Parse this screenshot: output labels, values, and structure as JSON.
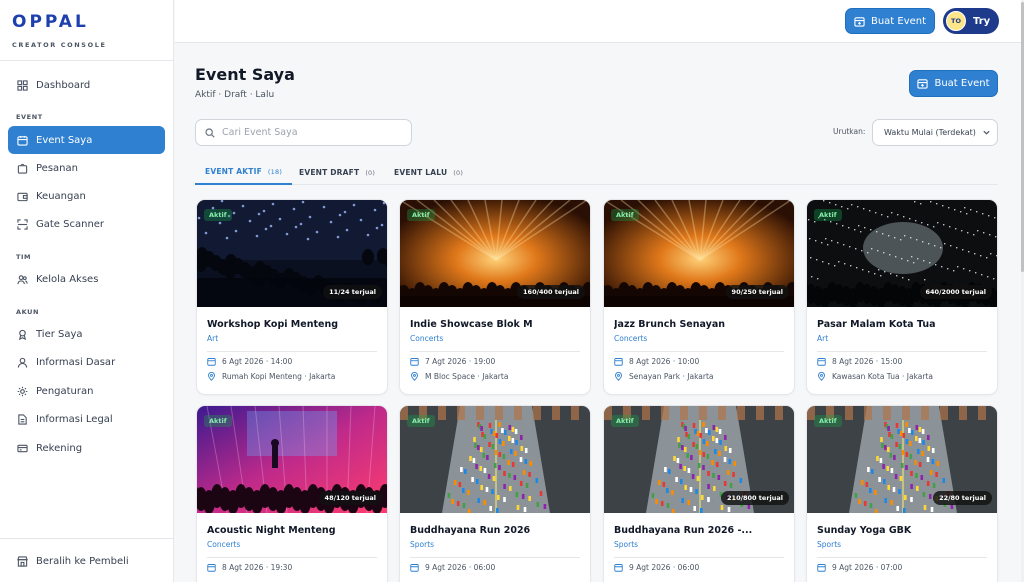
{
  "brand": {
    "name": "OPPAL",
    "subtitle": "CREATOR CONSOLE"
  },
  "colors": {
    "primary": "#2f80d1",
    "navy": "#1e3a8a",
    "success": "#16a34a"
  },
  "sidebar": {
    "sections": [
      {
        "label": ""
      },
      {
        "label": "EVENT"
      },
      {
        "label": "TIM"
      },
      {
        "label": "AKUN"
      }
    ],
    "items": [
      {
        "label": "Dashboard",
        "icon": "grid-icon",
        "active": false
      },
      {
        "label": "Event Saya",
        "icon": "calendar-icon",
        "active": true
      },
      {
        "label": "Pesanan",
        "icon": "bag-icon",
        "active": false
      },
      {
        "label": "Keuangan",
        "icon": "wallet-icon",
        "active": false
      },
      {
        "label": "Gate Scanner",
        "icon": "scan-icon",
        "active": false
      },
      {
        "label": "Kelola Akses",
        "icon": "users-icon",
        "active": false
      },
      {
        "label": "Tier Saya",
        "icon": "medal-icon",
        "active": false
      },
      {
        "label": "Informasi Dasar",
        "icon": "user-icon",
        "active": false
      },
      {
        "label": "Pengaturan",
        "icon": "gear-icon",
        "active": false
      },
      {
        "label": "Informasi Legal",
        "icon": "document-icon",
        "active": false
      },
      {
        "label": "Rekening",
        "icon": "card-icon",
        "active": false
      }
    ],
    "footer_label": "Beralih ke Pembeli"
  },
  "topbar": {
    "create_label": "Buat Event",
    "user_initials": "TO",
    "user_name": "Try"
  },
  "page": {
    "title": "Event Saya",
    "subtitle": "Aktif · Draft · Lalu",
    "create_label": "Buat Event",
    "search_placeholder": "Cari Event Saya",
    "sort_label": "Urutkan:",
    "sort_value": "Waktu Mulai (Terdekat)"
  },
  "tabs": [
    {
      "label": "EVENT AKTIF",
      "count": "(18)",
      "active": true
    },
    {
      "label": "EVENT DRAFT",
      "count": "(0)",
      "active": false
    },
    {
      "label": "EVENT LALU",
      "count": "(0)",
      "active": false
    }
  ],
  "events": [
    {
      "title": "Workshop Kopi Menteng",
      "category": "Art",
      "date": "6 Agt 2026 · 14:00",
      "location": "Rumah Kopi Menteng · Jakarta",
      "status": "Aktif",
      "sold": "11/24 terjual",
      "scene": "crowd-dark"
    },
    {
      "title": "Indie Showcase Blok M",
      "category": "Concerts",
      "date": "7 Agt 2026 · 19:00",
      "location": "M Bloc Space · Jakarta",
      "status": "Aktif",
      "sold": "160/400 terjual",
      "scene": "concert-orange"
    },
    {
      "title": "Jazz Brunch Senayan",
      "category": "Concerts",
      "date": "8 Agt 2026 · 10:00",
      "location": "Senayan Park · Jakarta",
      "status": "Aktif",
      "sold": "90/250 terjual",
      "scene": "concert-orange"
    },
    {
      "title": "Pasar Malam Kota Tua",
      "category": "Art",
      "date": "8 Agt 2026 · 15:00",
      "location": "Kawasan Kota Tua · Jakarta",
      "status": "Aktif",
      "sold": "640/2000 terjual",
      "scene": "confetti"
    },
    {
      "title": "Acoustic Night Menteng",
      "category": "Concerts",
      "date": "8 Agt 2026 · 19:30",
      "location": "",
      "status": "Aktif",
      "sold": "48/120 terjual",
      "scene": "stage-pink"
    },
    {
      "title": "Buddhayana Run 2026",
      "category": "Sports",
      "date": "9 Agt 2026 · 06:00",
      "location": "",
      "status": "Aktif",
      "sold": "",
      "scene": "marathon"
    },
    {
      "title": "Buddhayana Run 2026 -...",
      "category": "Sports",
      "date": "9 Agt 2026 · 06:00",
      "location": "",
      "status": "Aktif",
      "sold": "210/800 terjual",
      "scene": "marathon"
    },
    {
      "title": "Sunday Yoga GBK",
      "category": "Sports",
      "date": "9 Agt 2026 · 07:00",
      "location": "",
      "status": "Aktif",
      "sold": "22/80 terjual",
      "scene": "marathon"
    }
  ]
}
